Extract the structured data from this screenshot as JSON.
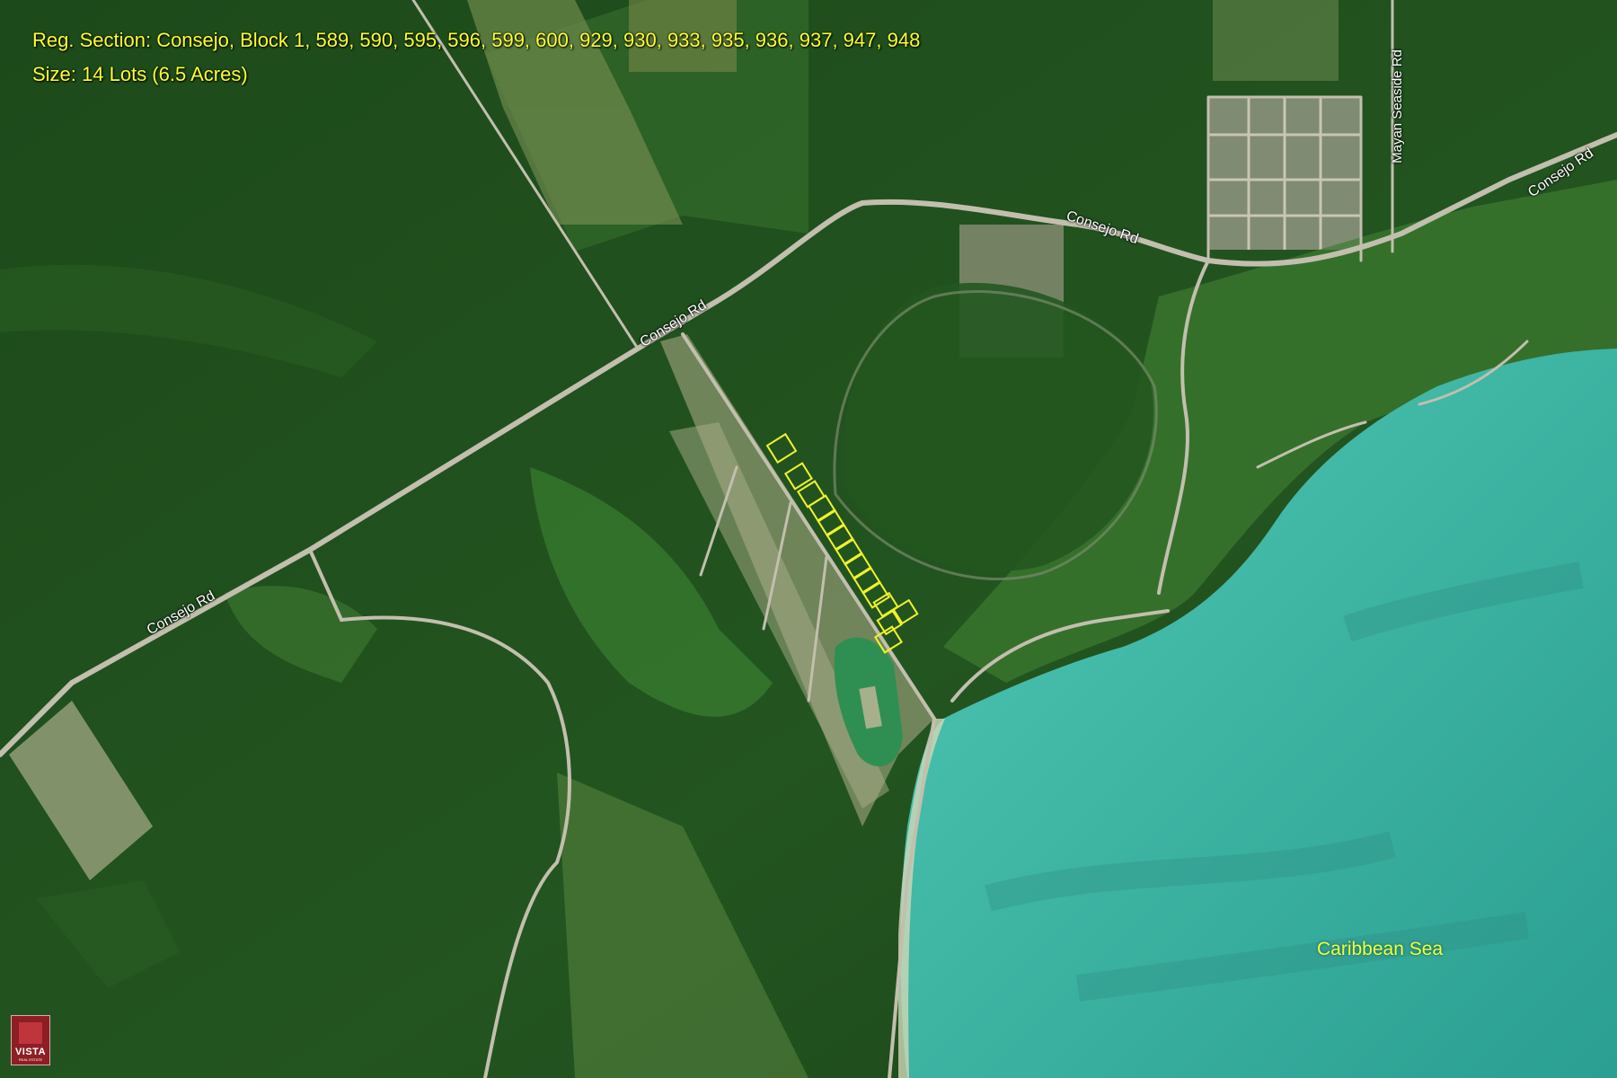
{
  "header": {
    "line1": "Reg. Section:  Consejo, Block 1, 589, 590, 595, 596, 599, 600, 929, 930, 933, 935, 936, 937, 947, 948",
    "line2": "Size:  14 Lots (6.5 Acres)"
  },
  "roads": {
    "consejo_rd_1": "Consejo Rd",
    "consejo_rd_2": "Consejo Rd",
    "consejo_rd_3": "Consejo Rd",
    "consejo_rd_4": "Consejo Rd",
    "mayan_seaside_rd": "Mayan Seaside Rd"
  },
  "water": {
    "sea_label": "Caribbean Sea"
  },
  "logo": {
    "word": "VISTA",
    "sub": "REAL ESTATE"
  },
  "colors": {
    "forest": "#1f4a1c",
    "sea": "#3fb6a6",
    "lot_outline": "#f2f22a",
    "label_yellow": "#ffff2e",
    "road": "#b9b7a6"
  },
  "lots": {
    "count": 14
  }
}
